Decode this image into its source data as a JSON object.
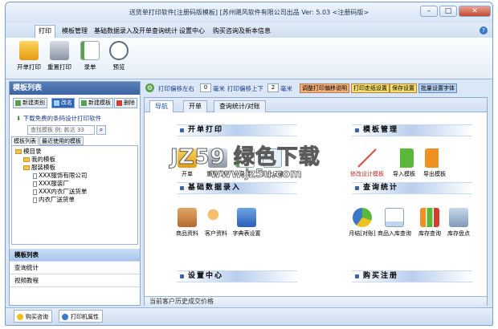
{
  "window": {
    "title": "送货单打印软件[注册码版模板] [苏州飓风软件有限公司出品 Ver: 5.03 <注册码版>"
  },
  "menu": {
    "items": [
      "打印",
      "模板管理",
      "基础数据录入及开单查询统计",
      "设置中心",
      "购买咨询及新本信息"
    ]
  },
  "ribbon": {
    "buttons": [
      "开单打印",
      "重置打印",
      "录单",
      "预览"
    ]
  },
  "left": {
    "title": "模板列表",
    "buttons": [
      "新建类别",
      "改名",
      "新建模板",
      "删除"
    ],
    "download_link": "下载免费的条码设计打印软件",
    "search_placeholder": "查找模板 例: 款达 33",
    "tabs": [
      "模板列表",
      "最近使用的模板"
    ],
    "tree": {
      "root": "模目录",
      "my_templates": "我的模板",
      "clothing": "服装模板",
      "items": [
        "XXX服饰有限公司",
        "XXX服装厂",
        "XXX内衣厂送货单",
        "内衣厂送货单"
      ]
    },
    "nav": [
      "模板列表",
      "查询统计",
      "视频教程"
    ]
  },
  "options": {
    "offset_lr_label": "打印偏移左右",
    "offset_lr": "0",
    "unit1": "毫米",
    "offset_ud_label": "打印偏移上下",
    "offset_ud": "2",
    "unit2": "毫米",
    "btn_explain": "调整打印偏移说明",
    "btn_paper": "打印走纸设置",
    "btn_save": "保存设置",
    "btn_font": "批量设置字体"
  },
  "main": {
    "tabs": [
      "导航",
      "开单",
      "查询统计/对账"
    ],
    "sections": {
      "print": "开单打印",
      "template": "模板管理",
      "basic": "基础数据录入",
      "query": "查询统计",
      "settings": "设置中心",
      "buy": "购买注册"
    },
    "print_tiles": [
      "开单",
      "重置打印",
      "录单",
      "历史记录"
    ],
    "template_tiles": [
      "修改设计模板",
      "导入模板",
      "导出模板"
    ],
    "basic_tiles": [
      "商品资料",
      "客户资料",
      "字典表设置"
    ],
    "query_tiles": [
      "月结[对账]",
      "商品入库查询",
      "库存查询",
      "库存盘点"
    ],
    "status_text": "当前客户历史成交价格"
  },
  "watermark": {
    "line1": "JZ59 绿色下载",
    "line2": "www.jz5u.com"
  },
  "statusbar": {
    "tabs": [
      "购买咨询",
      "打印机属性"
    ]
  }
}
